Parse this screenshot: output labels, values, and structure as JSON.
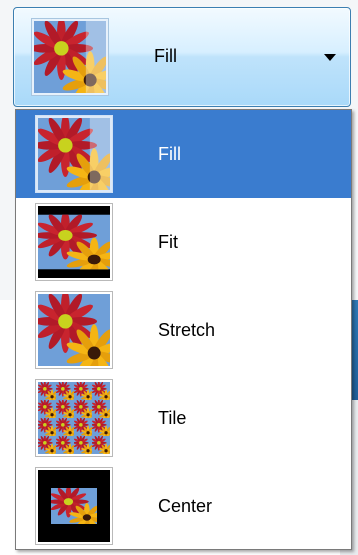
{
  "combo": {
    "selected_label": "Fill",
    "arrow_icon": "chevron-down-icon"
  },
  "options": [
    {
      "label": "Fill",
      "mode": "fill",
      "selected": true
    },
    {
      "label": "Fit",
      "mode": "fit",
      "selected": false
    },
    {
      "label": "Stretch",
      "mode": "stretch",
      "selected": false
    },
    {
      "label": "Tile",
      "mode": "tile",
      "selected": false
    },
    {
      "label": "Center",
      "mode": "center",
      "selected": false
    }
  ],
  "colors": {
    "selection": "#3a7ccf",
    "combo_border": "#3c7fb1",
    "sky": "#6f9fd8",
    "petal_red": "#c0202b",
    "petal_yellow": "#f5b514",
    "flower_center": "#c8d21e"
  }
}
